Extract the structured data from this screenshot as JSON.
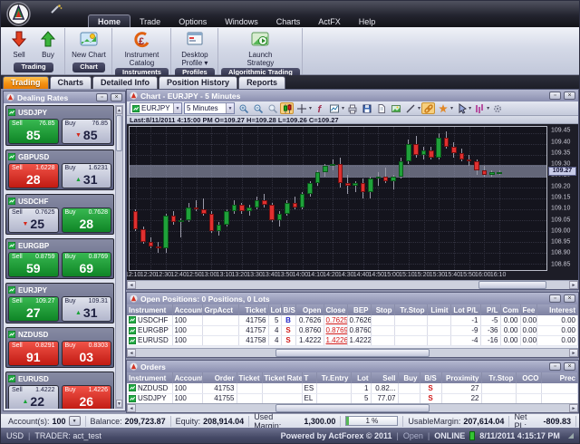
{
  "menu": {
    "items": [
      "Home",
      "Trade",
      "Options",
      "Windows",
      "Charts",
      "ActFX",
      "Help"
    ],
    "active_index": 0
  },
  "ribbon": {
    "groups": [
      {
        "label": "Trading",
        "buttons": [
          {
            "label": "Sell",
            "icon": "sell-arrow-down",
            "narrow": true
          },
          {
            "label": "Buy",
            "icon": "buy-arrow-up",
            "narrow": true
          }
        ]
      },
      {
        "label": "Chart",
        "buttons": [
          {
            "label": "New Chart",
            "icon": "new-chart"
          }
        ]
      },
      {
        "label": "Instruments",
        "buttons": [
          {
            "label": "Instrument Catalog",
            "icon": "instrument-catalog"
          }
        ]
      },
      {
        "label": "Profiles",
        "buttons": [
          {
            "label": "Desktop Profile",
            "icon": "desktop-profile",
            "dropdown": true
          }
        ]
      },
      {
        "label": "Algorithmic Trading",
        "buttons": [
          {
            "label": "Launch Strategy",
            "icon": "launch-strategy"
          }
        ]
      }
    ]
  },
  "doc_tabs": {
    "items": [
      "Trading",
      "Charts",
      "Detailed Info",
      "Position History",
      "Reports"
    ],
    "active_index": 0
  },
  "dealing_rates": {
    "title": "Dealing Rates",
    "tiles": [
      {
        "pair": "USDJPY",
        "sell": {
          "label": "Sell",
          "price": "76.85",
          "big": "85",
          "style": "g",
          "arrow": ""
        },
        "buy": {
          "label": "Buy",
          "price": "76.85",
          "big": "85",
          "style": "n",
          "arrow": "down"
        }
      },
      {
        "pair": "GBPUSD",
        "sell": {
          "label": "Sell",
          "price": "1.6228",
          "big": "28",
          "style": "r",
          "arrow": ""
        },
        "buy": {
          "label": "Buy",
          "price": "1.6231",
          "big": "31",
          "style": "n",
          "arrow": "up"
        }
      },
      {
        "pair": "USDCHF",
        "sell": {
          "label": "Sell",
          "price": "0.7625",
          "big": "25",
          "style": "n",
          "arrow": "down"
        },
        "buy": {
          "label": "Buy",
          "price": "0.7628",
          "big": "28",
          "style": "g",
          "arrow": ""
        }
      },
      {
        "pair": "EURGBP",
        "sell": {
          "label": "Sell",
          "price": "0.8759",
          "big": "59",
          "style": "g",
          "arrow": ""
        },
        "buy": {
          "label": "Buy",
          "price": "0.8769",
          "big": "69",
          "style": "g",
          "arrow": ""
        }
      },
      {
        "pair": "EURJPY",
        "sell": {
          "label": "Sell",
          "price": "109.27",
          "big": "27",
          "style": "g",
          "arrow": ""
        },
        "buy": {
          "label": "Buy",
          "price": "109.31",
          "big": "31",
          "style": "n",
          "arrow": "up"
        }
      },
      {
        "pair": "NZDUSD",
        "sell": {
          "label": "Sell",
          "price": "0.8291",
          "big": "91",
          "style": "r",
          "arrow": ""
        },
        "buy": {
          "label": "Buy",
          "price": "0.8303",
          "big": "03",
          "style": "r",
          "arrow": ""
        }
      },
      {
        "pair": "EURUSD",
        "sell": {
          "label": "Sell",
          "price": "1.4222",
          "big": "22",
          "style": "n",
          "arrow": "up"
        },
        "buy": {
          "label": "Buy",
          "price": "1.4226",
          "big": "26",
          "style": "r",
          "arrow": ""
        }
      }
    ]
  },
  "chart": {
    "panel_title": "Chart - EURJPY - 5 Minutes",
    "symbol": "EURJPY",
    "period": "5 Minutes",
    "status_line": "Last:8/11/2011 4:15:00 PM O=109.27 H=109.28 L=109.26 C=109.27",
    "toolbar_icons": [
      {
        "name": "zoom-in"
      },
      {
        "name": "zoom-out"
      },
      {
        "name": "zoom-reset"
      },
      {
        "name": "candlestick-style",
        "active": true
      },
      {
        "name": "crosshair",
        "dropdown": true
      },
      {
        "name": "indicators"
      },
      {
        "name": "chart-layout",
        "dropdown": true
      },
      {
        "name": "print"
      },
      {
        "name": "save"
      },
      {
        "name": "copy-page"
      },
      {
        "name": "export-image"
      },
      {
        "name": "trend-line",
        "dropdown": true
      },
      {
        "name": "link-charts",
        "active": true
      },
      {
        "name": "annotations",
        "dropdown": true
      },
      {
        "name": "pointer-tool",
        "dropdown": true
      },
      {
        "name": "oscillator",
        "dropdown": true
      },
      {
        "name": "settings"
      }
    ]
  },
  "chart_data": {
    "type": "candlestick",
    "title": "EURJPY - 5 Minutes",
    "ylim": [
      108.82,
      109.48
    ],
    "grid": true,
    "current_price": "109.27",
    "highlight_band": [
      109.245,
      109.305
    ],
    "y_ticks": [
      "109.45",
      "109.40",
      "109.35",
      "109.30",
      "109.25",
      "109.20",
      "109.15",
      "109.10",
      "109.05",
      "109.00",
      "108.95",
      "108.90",
      "108.85"
    ],
    "x_ticks": [
      "12:10",
      "12:20",
      "12:30",
      "12:40",
      "12:50",
      "13:00",
      "13:10",
      "13:20",
      "13:30",
      "13:40",
      "13:50",
      "14:00",
      "14:10",
      "14:20",
      "14:30",
      "14:40",
      "14:50",
      "15:00",
      "15:10",
      "15:20",
      "15:30",
      "15:40",
      "15:50",
      "16:00",
      "16:10"
    ],
    "times": [
      "12:10",
      "12:15",
      "12:20",
      "12:25",
      "12:30",
      "12:35",
      "12:40",
      "12:45",
      "12:50",
      "12:55",
      "13:00",
      "13:05",
      "13:10",
      "13:15",
      "13:20",
      "13:25",
      "13:30",
      "13:35",
      "13:40",
      "13:45",
      "13:50",
      "13:55",
      "14:00",
      "14:05",
      "14:10",
      "14:15",
      "14:20",
      "14:25",
      "14:30",
      "14:35",
      "14:40",
      "14:45",
      "14:50",
      "14:55",
      "15:00",
      "15:05",
      "15:10",
      "15:15",
      "15:20",
      "15:25",
      "15:30",
      "15:35",
      "15:40",
      "15:45",
      "15:50",
      "15:55",
      "16:00",
      "16:05",
      "16:10"
    ],
    "candles_ohlc": [
      [
        109.09,
        109.1,
        109.0,
        109.01
      ],
      [
        109.01,
        109.02,
        108.94,
        108.95
      ],
      [
        108.95,
        108.97,
        108.92,
        108.93
      ],
      [
        108.93,
        108.95,
        108.9,
        108.92
      ],
      [
        108.92,
        109.08,
        108.9,
        109.07
      ],
      [
        109.07,
        109.09,
        109.03,
        109.04
      ],
      [
        109.04,
        109.06,
        108.97,
        109.05
      ],
      [
        109.05,
        109.13,
        109.04,
        109.11
      ],
      [
        109.11,
        109.14,
        109.09,
        109.1
      ],
      [
        109.1,
        109.15,
        109.07,
        109.08
      ],
      [
        109.08,
        109.09,
        108.99,
        109.0
      ],
      [
        109.0,
        109.04,
        108.98,
        109.03
      ],
      [
        109.03,
        109.1,
        109.02,
        109.09
      ],
      [
        109.09,
        109.14,
        109.08,
        109.12
      ],
      [
        109.12,
        109.13,
        109.08,
        109.09
      ],
      [
        109.09,
        109.12,
        109.07,
        109.11
      ],
      [
        109.11,
        109.16,
        109.1,
        109.14
      ],
      [
        109.14,
        109.17,
        109.11,
        109.12
      ],
      [
        109.12,
        109.13,
        109.04,
        109.05
      ],
      [
        109.05,
        109.09,
        109.02,
        109.08
      ],
      [
        109.08,
        109.14,
        109.07,
        109.13
      ],
      [
        109.13,
        109.16,
        109.1,
        109.11
      ],
      [
        109.11,
        109.18,
        109.1,
        109.17
      ],
      [
        109.17,
        109.23,
        109.16,
        109.22
      ],
      [
        109.22,
        109.28,
        109.21,
        109.27
      ],
      [
        109.27,
        109.31,
        109.25,
        109.3
      ],
      [
        109.3,
        109.33,
        109.28,
        109.31
      ],
      [
        109.31,
        109.34,
        109.2,
        109.22
      ],
      [
        109.22,
        109.26,
        109.17,
        109.21
      ],
      [
        109.21,
        109.23,
        109.18,
        109.22
      ],
      [
        109.22,
        109.24,
        109.15,
        109.18
      ],
      [
        109.18,
        109.25,
        109.15,
        109.24
      ],
      [
        109.24,
        109.27,
        109.21,
        109.25
      ],
      [
        109.25,
        109.29,
        109.22,
        109.23
      ],
      [
        109.23,
        109.26,
        109.19,
        109.25
      ],
      [
        109.25,
        109.34,
        109.24,
        109.32
      ],
      [
        109.32,
        109.42,
        109.31,
        109.4
      ],
      [
        109.4,
        109.44,
        109.34,
        109.35
      ],
      [
        109.35,
        109.39,
        109.33,
        109.37
      ],
      [
        109.37,
        109.39,
        109.33,
        109.34
      ],
      [
        109.34,
        109.45,
        109.33,
        109.43
      ],
      [
        109.43,
        109.46,
        109.38,
        109.39
      ],
      [
        109.39,
        109.41,
        109.34,
        109.36
      ],
      [
        109.36,
        109.38,
        109.32,
        109.33
      ],
      [
        109.33,
        109.35,
        109.3,
        109.32
      ],
      [
        109.32,
        109.33,
        109.26,
        109.28
      ],
      [
        109.28,
        109.3,
        109.25,
        109.26
      ],
      [
        109.26,
        109.28,
        109.25,
        109.27
      ],
      [
        109.27,
        109.28,
        109.26,
        109.27
      ]
    ]
  },
  "positions": {
    "title": "Open Positions: 0 Positions, 0 Lots",
    "columns": [
      {
        "label": "Instrument",
        "w": 50,
        "align": "al",
        "type": "pair"
      },
      {
        "label": "Account",
        "w": 33,
        "align": "al"
      },
      {
        "label": "GrpAcct",
        "w": 40,
        "align": "al"
      },
      {
        "label": "Ticket",
        "w": 33,
        "align": "ar"
      },
      {
        "label": "Lot",
        "w": 14,
        "align": "ar"
      },
      {
        "label": "B/S",
        "w": 16,
        "align": "ac",
        "type": "bs"
      },
      {
        "label": "Open",
        "w": 31,
        "align": "ar"
      },
      {
        "label": "Close",
        "w": 26,
        "align": "ar",
        "type": "close"
      },
      {
        "label": "BEP",
        "w": 26,
        "align": "ar"
      },
      {
        "label": "Stop",
        "w": 26,
        "align": "ar"
      },
      {
        "label": "Tr.Stop",
        "w": 36,
        "align": "ar"
      },
      {
        "label": "Limit",
        "w": 26,
        "align": "ar"
      },
      {
        "label": "Lot P/L",
        "w": 33,
        "align": "ar"
      },
      {
        "label": "P/L",
        "w": 22,
        "align": "ar"
      },
      {
        "label": "Com",
        "w": 22,
        "align": "ar"
      },
      {
        "label": "Fee",
        "w": 18,
        "align": "ar"
      },
      {
        "label": "Interest",
        "w": 0,
        "align": "ar"
      }
    ],
    "rows": [
      [
        "USDCHF",
        "100",
        "",
        "41756",
        "5",
        "B",
        "0.7626",
        "0.7625",
        "0.7626",
        "",
        "",
        "",
        "-1",
        "-5",
        "0.00",
        "0.00",
        "0.00"
      ],
      [
        "EURGBP",
        "100",
        "",
        "41757",
        "4",
        "S",
        "0.8760",
        "0.8769",
        "0.8760",
        "",
        "",
        "",
        "-9",
        "-36",
        "0.00",
        "0.00",
        "0.00"
      ],
      [
        "EURUSD",
        "100",
        "",
        "41758",
        "4",
        "S",
        "1.4222",
        "1.4226",
        "1.4222",
        "",
        "",
        "",
        "-4",
        "-16",
        "0.00",
        "0.00",
        "0.00"
      ]
    ]
  },
  "orders": {
    "title": "Orders",
    "columns": [
      {
        "label": "Instrument",
        "w": 50,
        "align": "al",
        "type": "pair"
      },
      {
        "label": "Account",
        "w": 33,
        "align": "al"
      },
      {
        "label": "Order",
        "w": 38,
        "align": "ar"
      },
      {
        "label": "Ticket",
        "w": 28,
        "align": "ar"
      },
      {
        "label": "Ticket Rate",
        "w": 44,
        "align": "ar"
      },
      {
        "label": "T",
        "w": 16,
        "align": "al"
      },
      {
        "label": "Tr.Entry",
        "w": 38,
        "align": "ar"
      },
      {
        "label": "Lot",
        "w": 22,
        "align": "ar"
      },
      {
        "label": "Sell",
        "w": 30,
        "align": "ar"
      },
      {
        "label": "Buy",
        "w": 24,
        "align": "ar"
      },
      {
        "label": "B/S",
        "w": 24,
        "align": "ac",
        "type": "bs"
      },
      {
        "label": "Proximity",
        "w": 44,
        "align": "ar"
      },
      {
        "label": "Tr.Stop",
        "w": 38,
        "align": "ar"
      },
      {
        "label": "OCO",
        "w": 28,
        "align": "ar"
      },
      {
        "label": "Prec",
        "w": 0,
        "align": "ar"
      }
    ],
    "rows": [
      [
        "NZDUSD",
        "100",
        "41753",
        "",
        "",
        "ES",
        "",
        "1",
        "0.82...",
        "",
        "S",
        "27",
        "",
        "",
        ""
      ],
      [
        "USDJPY",
        "100",
        "41755",
        "",
        "",
        "EL",
        "",
        "5",
        "77.07",
        "",
        "S",
        "22",
        "",
        "",
        ""
      ]
    ]
  },
  "status_bar": {
    "segments": [
      {
        "label": "Account(s):",
        "value": "100",
        "dropdown": true
      },
      {
        "label": "Balance:",
        "value": "209,723.87"
      },
      {
        "label": "Equity:",
        "value": "208,914.04"
      },
      {
        "label": "Used Margin:",
        "value": "1,300.00"
      },
      {
        "type": "progress",
        "text": "1 %"
      },
      {
        "label": "UsableMargin:",
        "value": "207,614.04"
      },
      {
        "label": "Net PL:",
        "value": "-809.83"
      }
    ]
  },
  "bottom_bar": {
    "currency": "USD",
    "trader": "TRADER: act_test",
    "powered": "Powered by ActForex © 2011",
    "open_label": "Open",
    "online_label": "ONLINE",
    "datetime": "8/11/2011 4:15:17 PM"
  },
  "colors": {
    "up": "#1fa13a",
    "down": "#e03030",
    "accent_orange": "#f49012",
    "band": "#989db6"
  }
}
